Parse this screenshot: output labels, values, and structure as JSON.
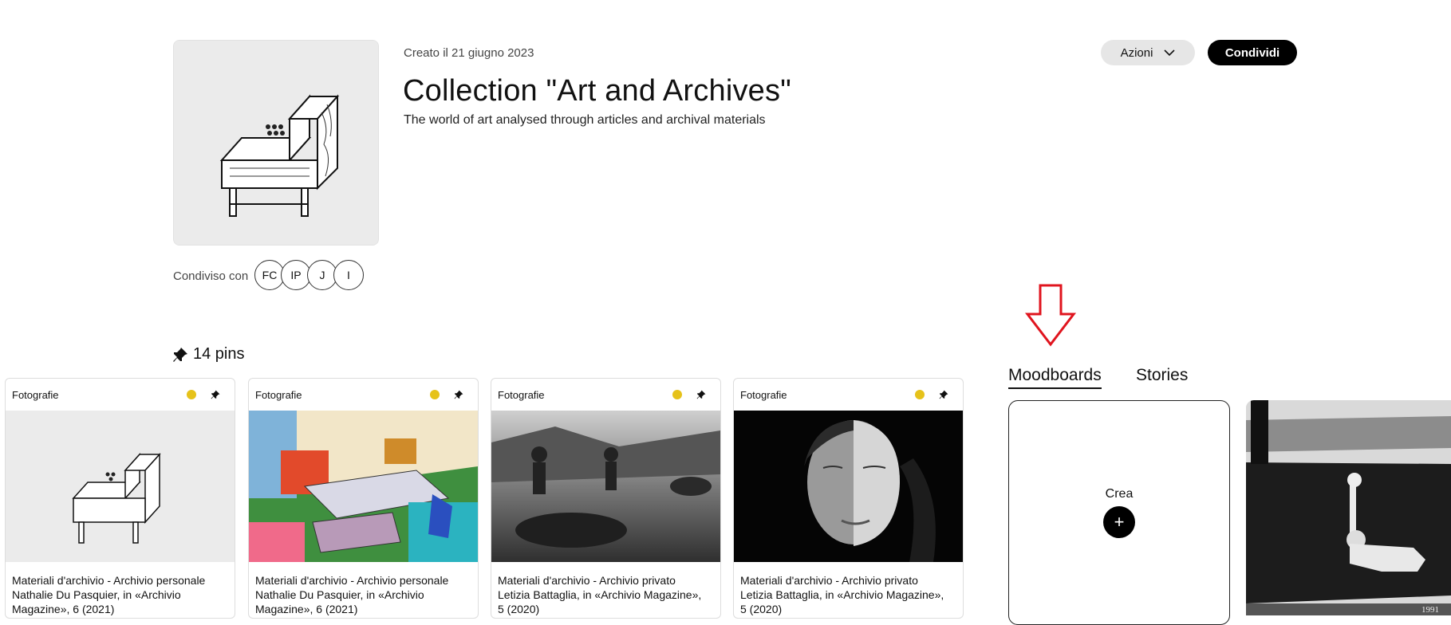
{
  "header": {
    "created": "Creato il 21 giugno 2023",
    "title": "Collection \"Art and Archives\"",
    "subtitle": "The world of art analysed through articles and archival materials",
    "actions_label": "Azioni",
    "share_label": "Condividi"
  },
  "shared": {
    "label": "Condiviso con",
    "avatars": [
      "FC",
      "IP",
      "J",
      "I"
    ]
  },
  "pins": {
    "count_label": "14 pins"
  },
  "tabs": {
    "moodboards": "Moodboards",
    "stories": "Stories"
  },
  "create": {
    "label": "Crea",
    "button": "+"
  },
  "cards": [
    {
      "category": "Fotografie",
      "lines": [
        "Materiali d'archivio - Archivio personale",
        "Nathalie Du Pasquier, in «Archivio",
        "Magazine», 6 (2021)"
      ]
    },
    {
      "category": "Fotografie",
      "lines": [
        "Materiali d'archivio - Archivio personale",
        "Nathalie Du Pasquier, in «Archivio",
        "Magazine», 6 (2021)"
      ]
    },
    {
      "category": "Fotografie",
      "lines": [
        "Materiali d'archivio - Archivio privato",
        "Letizia Battaglia, in «Archivio Magazine»,",
        "5 (2020)"
      ]
    },
    {
      "category": "Fotografie",
      "lines": [
        "Materiali d'archivio - Archivio privato",
        "Letizia Battaglia, in «Archivio Magazine»,",
        "5 (2020)"
      ]
    }
  ],
  "moodboard_year": "1991",
  "colors": {
    "accent_dot": "#e6c21a",
    "arrow": "#e0141e",
    "primary_button": "#000000"
  }
}
